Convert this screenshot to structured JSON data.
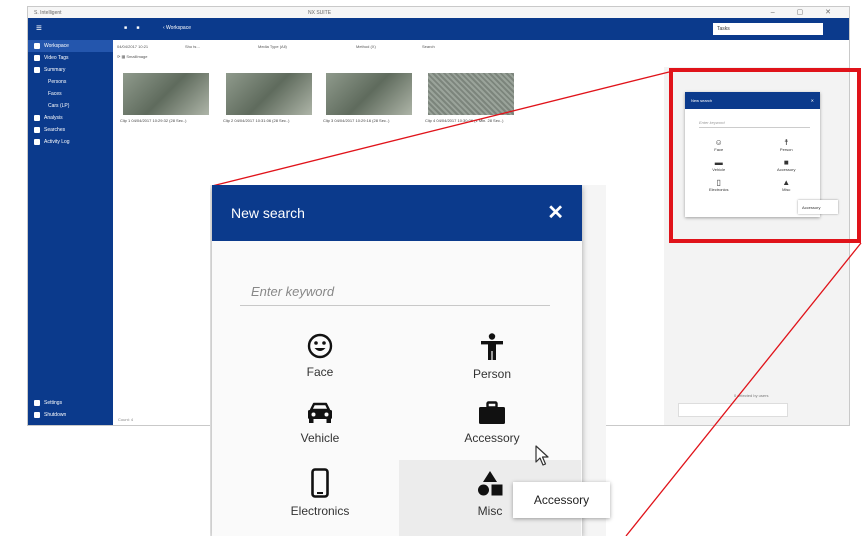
{
  "window": {
    "app_name": "S. Intelligent",
    "title": "NX SUITE",
    "controls": "– ▢ ✕"
  },
  "topbar": {
    "breadcrumb": "‹  Workspace",
    "nav_icons": "■ ■",
    "search_box": "Tasks"
  },
  "sidebar": {
    "items": [
      {
        "label": "Workspace",
        "active": true
      },
      {
        "label": "Video Tags",
        "active": false
      },
      {
        "label": "Summary",
        "active": false
      },
      {
        "label": "Persons",
        "sub": true
      },
      {
        "label": "Faces",
        "sub": true
      },
      {
        "label": "Cars (LP)",
        "sub": true
      },
      {
        "label": "Analysis",
        "active": false
      },
      {
        "label": "Searches",
        "active": false
      },
      {
        "label": "Activity Log",
        "active": false
      }
    ],
    "bottom": [
      {
        "label": "Settings"
      },
      {
        "label": "Shutdown"
      }
    ]
  },
  "toolbar": {
    "date": "04/04/2017 10:21",
    "date2": "Sho ts…",
    "media_type": "Media Type (All)",
    "method": "Method (X)",
    "search": "Search",
    "view_mode": "SmallImage"
  },
  "thumbnails": [
    {
      "caption": "Clip 1  04/04/2017 10:29:32  (28 Sec..)"
    },
    {
      "caption": "Clip 2  04/04/2017 10:31:06  (28 Sec..)"
    },
    {
      "caption": "Clip 3  04/04/2017 10:29:16  (28 Sec..)"
    },
    {
      "caption": "Clip 4  04/04/2017 10:30:06  (1 Min. 28 Sec..)"
    }
  ],
  "right_panel": {
    "status": "0 selected by users"
  },
  "footer": {
    "count": "Count: 4"
  },
  "dialog": {
    "title": "New search",
    "close": "✕",
    "keyword_placeholder": "Enter keyword",
    "categories": {
      "face": "Face",
      "person": "Person",
      "vehicle": "Vehicle",
      "accessory": "Accessory",
      "electronics": "Electronics",
      "misc": "Misc"
    }
  },
  "tooltip": {
    "text": "Accessory"
  },
  "colors": {
    "primary": "#0b3a8c",
    "highlight": "#e0131a",
    "dialog_bg": "#fafafa"
  },
  "icons": [
    "face-icon",
    "person-icon",
    "vehicle-icon",
    "accessory-icon",
    "electronics-icon",
    "misc-icon",
    "close-icon",
    "cursor-icon"
  ]
}
